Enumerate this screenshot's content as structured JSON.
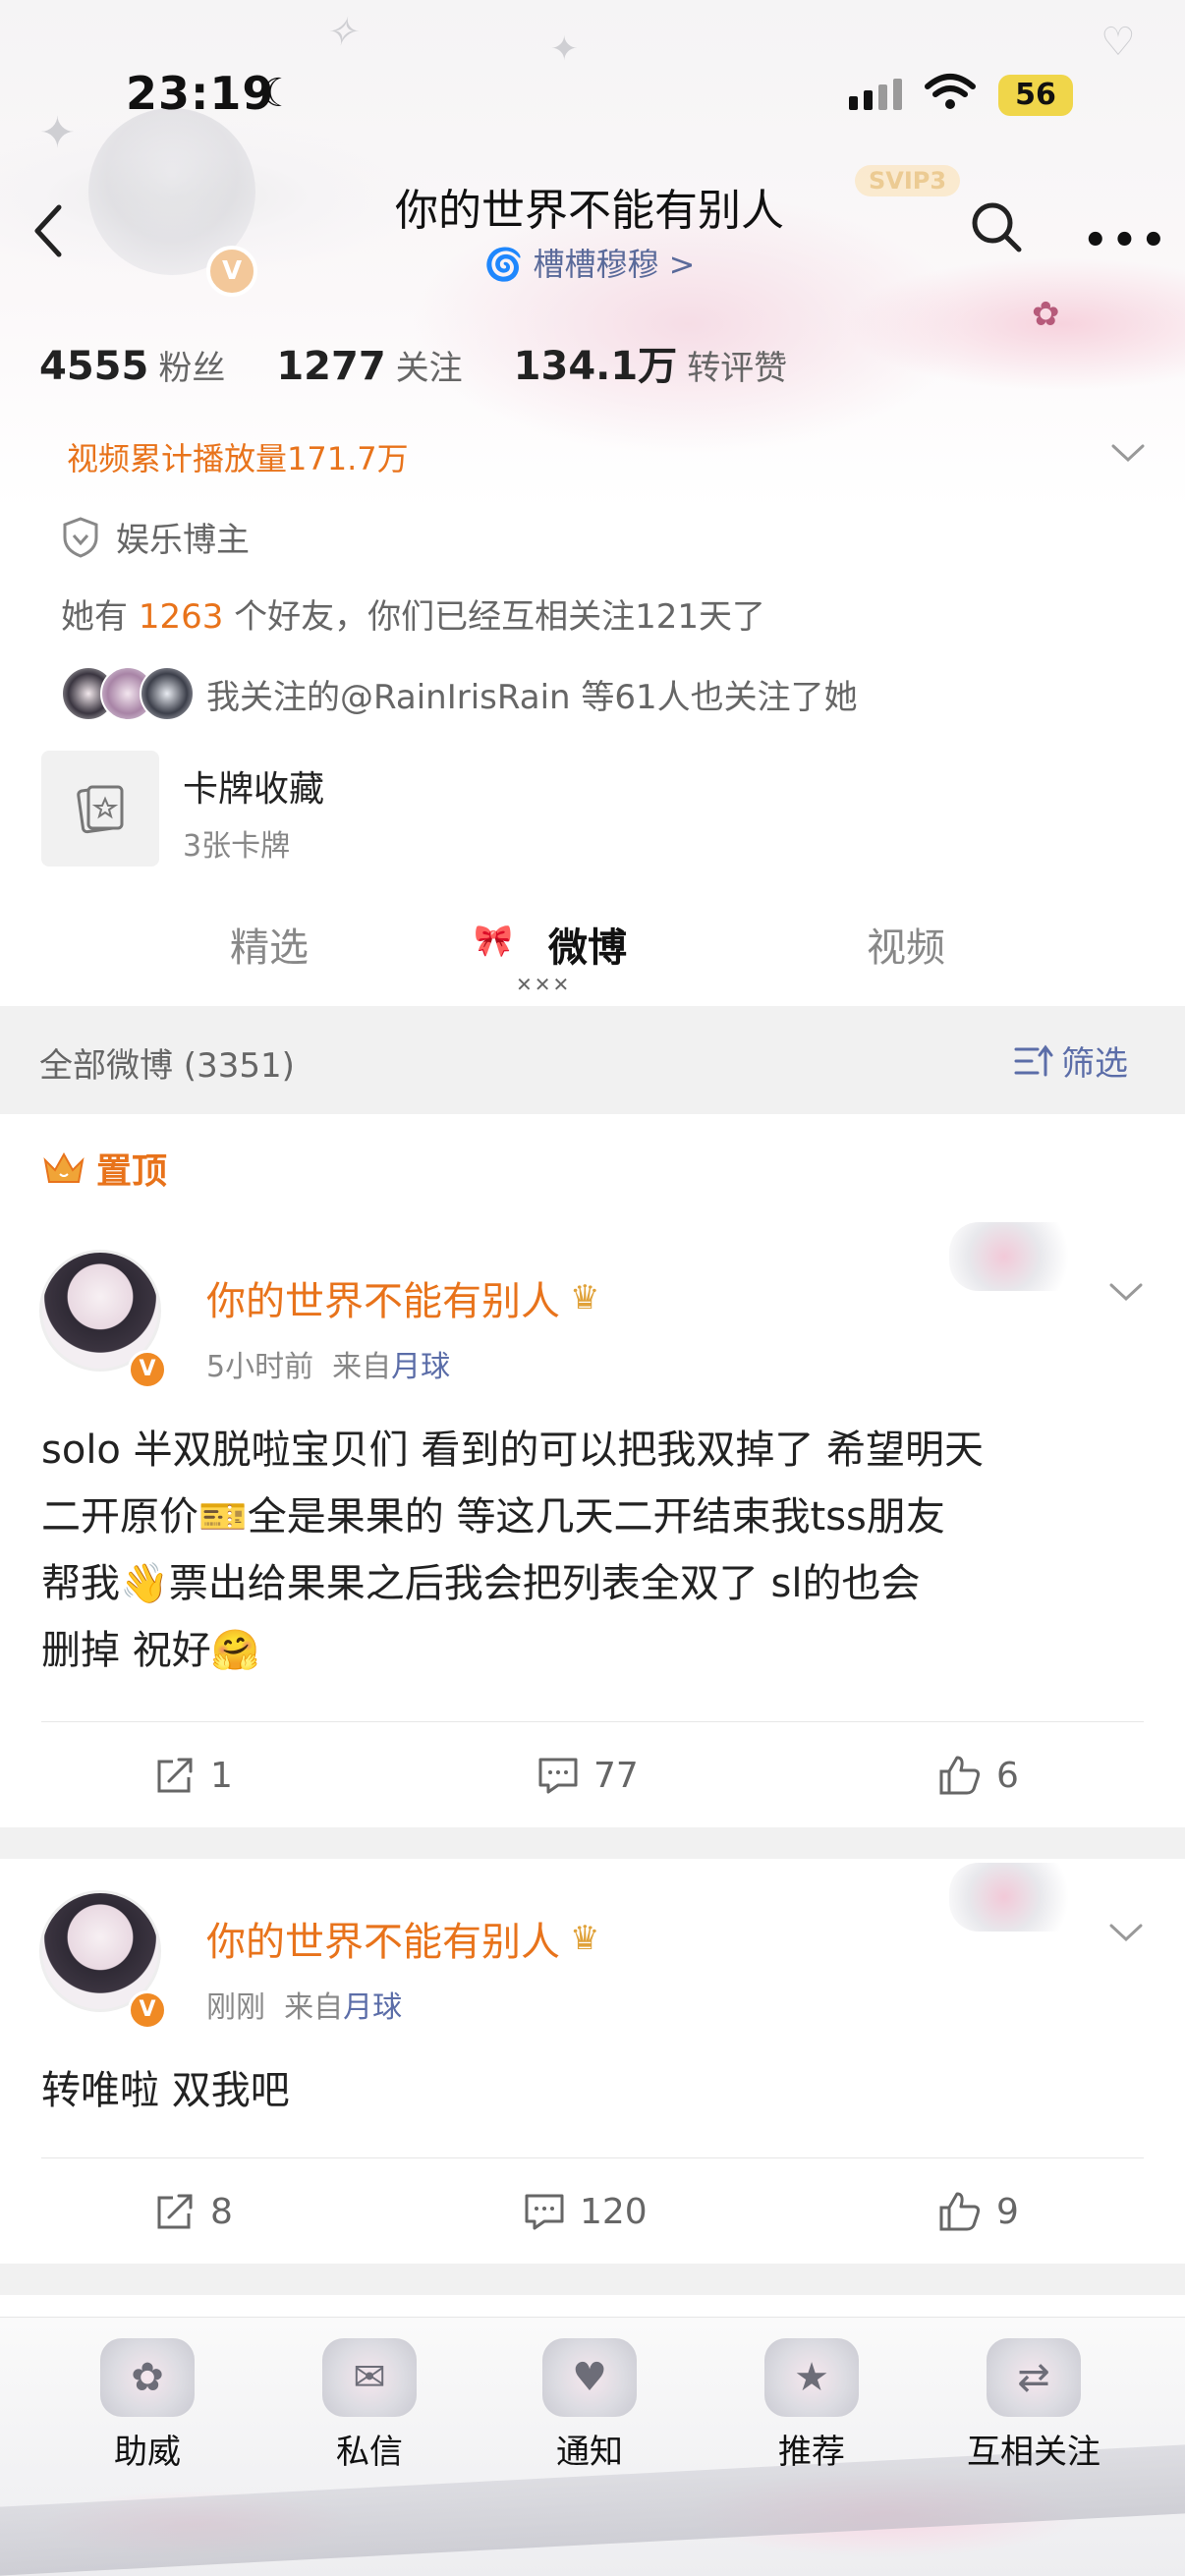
{
  "status_bar": {
    "time": "23:19",
    "battery": "56"
  },
  "nav": {
    "title": "你的世界不能有别人",
    "subtitle": "🌀 槽槽穆穆 >",
    "svip": "SVIP3"
  },
  "stats": [
    {
      "value": "4555",
      "label": "粉丝"
    },
    {
      "value": "1277",
      "label": "关注"
    },
    {
      "value": "134.1万",
      "label": "转评赞"
    }
  ],
  "play_count": "视频累计播放量171.7万",
  "role": "娱乐博主",
  "friends": {
    "prefix": "她有 ",
    "count": "1263",
    "suffix": " 个好友，你们已经互相关注121天了"
  },
  "mutual_follow": "我关注的@RainIrisRain 等61人也关注了她",
  "card_collection": {
    "title": "卡牌收藏",
    "subtitle": "3张卡牌"
  },
  "tabs": [
    {
      "label": "精选"
    },
    {
      "label": "微博"
    },
    {
      "label": "视频"
    }
  ],
  "filter": {
    "label": "全部微博 (3351)",
    "button": "筛选"
  },
  "pinned_label": "置顶",
  "posts": [
    {
      "author": "你的世界不能有别人",
      "time": "5小时前",
      "from_prefix": "来自",
      "source": "月球",
      "text_lines": [
        "solo 半双脱啦宝贝们 看到的可以把我双掉了 希望明天",
        "二开原价🎫全是果果的 等这几天二开结束我tss朋友",
        "帮我👋票出给果果之后我会把列表全双了 sl的也会",
        "删掉 祝好🤗"
      ],
      "reposts": "1",
      "comments": "77",
      "likes": "6"
    },
    {
      "author": "你的世界不能有别人",
      "time": "刚刚",
      "from_prefix": "来自",
      "source": "月球",
      "text_lines": [
        "转唯啦 双我吧"
      ],
      "reposts": "8",
      "comments": "120",
      "likes": "9"
    }
  ],
  "bottom_bar": [
    {
      "label": "助威",
      "icon": "cheer-icon"
    },
    {
      "label": "私信",
      "icon": "message-icon"
    },
    {
      "label": "通知",
      "icon": "bell-icon"
    },
    {
      "label": "推荐",
      "icon": "recommend-icon"
    },
    {
      "label": "互相关注",
      "icon": "mutual-follow-icon"
    }
  ],
  "colors": {
    "accent_orange": "#e8731b",
    "link_blue": "#5b6da8",
    "band_gray": "#f1f1f1"
  }
}
